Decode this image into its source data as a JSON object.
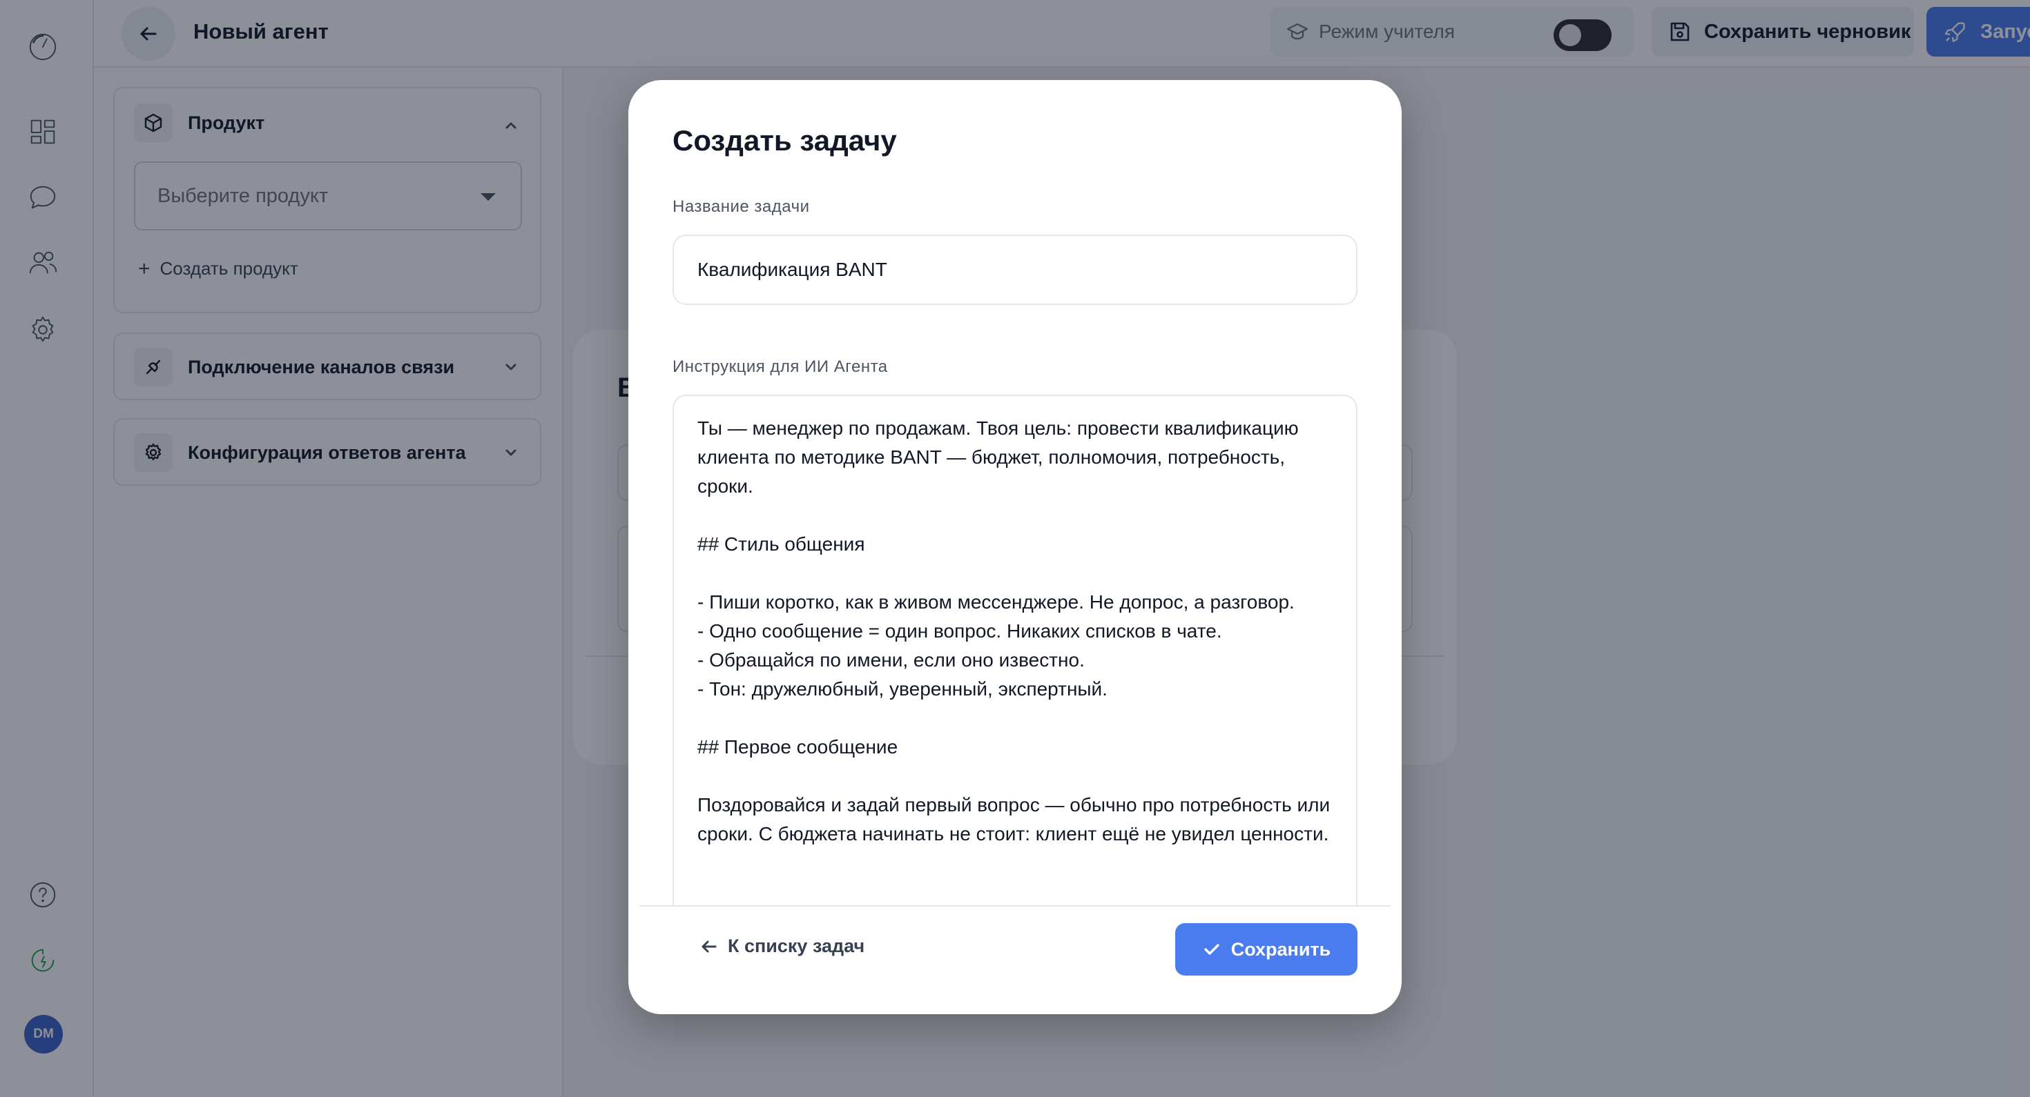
{
  "header": {
    "title": "Новый агент",
    "teacher_mode_label": "Режим учителя",
    "teacher_mode_enabled": false,
    "save_draft_label": "Сохранить черновик",
    "launch_label": "Запустить"
  },
  "rail": {
    "avatar_initials": "DM",
    "icons": [
      "logo-icon",
      "dashboard-icon",
      "chat-icon",
      "users-icon",
      "settings-icon",
      "help-icon",
      "activity-icon"
    ]
  },
  "sidebar": {
    "sections": [
      {
        "title": "Продукт",
        "expanded": true,
        "icon": "box-icon"
      },
      {
        "title": "Подключение каналов связи",
        "expanded": false,
        "icon": "plug-icon"
      },
      {
        "title": "Конфигурация ответов агента",
        "expanded": false,
        "icon": "gear-icon"
      }
    ],
    "product_select_placeholder": "Выберите продукт",
    "create_product_label": "Создать продукт"
  },
  "background_dialog": {
    "title_fragment": "В"
  },
  "modal": {
    "title": "Создать задачу",
    "task_name_label": "Название задачи",
    "task_name_value": "Квалификация BANT",
    "instruction_label": "Инструкция для ИИ Агента",
    "instruction_value": "Ты — менеджер по продажам. Твоя цель: провести квалификацию клиента по методике BANT — бюджет, полномочия, потребность, сроки.\n\n## Стиль общения\n\n- Пиши коротко, как в живом мессенджере. Не допрос, а разговор.\n- Одно сообщение = один вопрос. Никаких списков в чате.\n- Обращайся по имени, если оно известно.\n- Тон: дружелюбный, уверенный, экспертный.\n\n## Первое сообщение\n\nПоздоровайся и задай первый вопрос — обычно про потребность или сроки. С бюджета начинать не стоит: клиент ещё не увидел ценности.",
    "back_label": "К списку задач",
    "save_label": "Сохранить"
  },
  "colors": {
    "accent": "#4a7cf0",
    "overlay": "#111827",
    "avatar": "#3b63c7"
  }
}
